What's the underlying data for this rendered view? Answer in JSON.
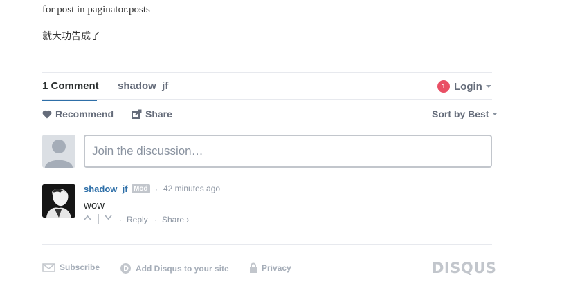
{
  "article": {
    "line1": "for post in paginator.posts",
    "line2": "就大功告成了"
  },
  "tabs": [
    {
      "label": "1 Comment"
    },
    {
      "label": "shadow_jf"
    }
  ],
  "login": {
    "badge_count": "1",
    "label": "Login"
  },
  "actions": {
    "recommend": "Recommend",
    "share": "Share",
    "sort": "Sort by Best"
  },
  "composer": {
    "placeholder": "Join the discussion…"
  },
  "comment": {
    "author": "shadow_jf",
    "badge": "Mod",
    "separator": "·",
    "timestamp": "42 minutes ago",
    "body": "wow",
    "reply": "Reply",
    "share": "Share ›"
  },
  "footer": {
    "subscribe": "Subscribe",
    "add_disqus": "Add Disqus to your site",
    "privacy": "Privacy",
    "logo": "DISQUS"
  },
  "colors": {
    "link": "#2e6fa8",
    "badge": "#e94f65",
    "muted": "#656c7a"
  }
}
